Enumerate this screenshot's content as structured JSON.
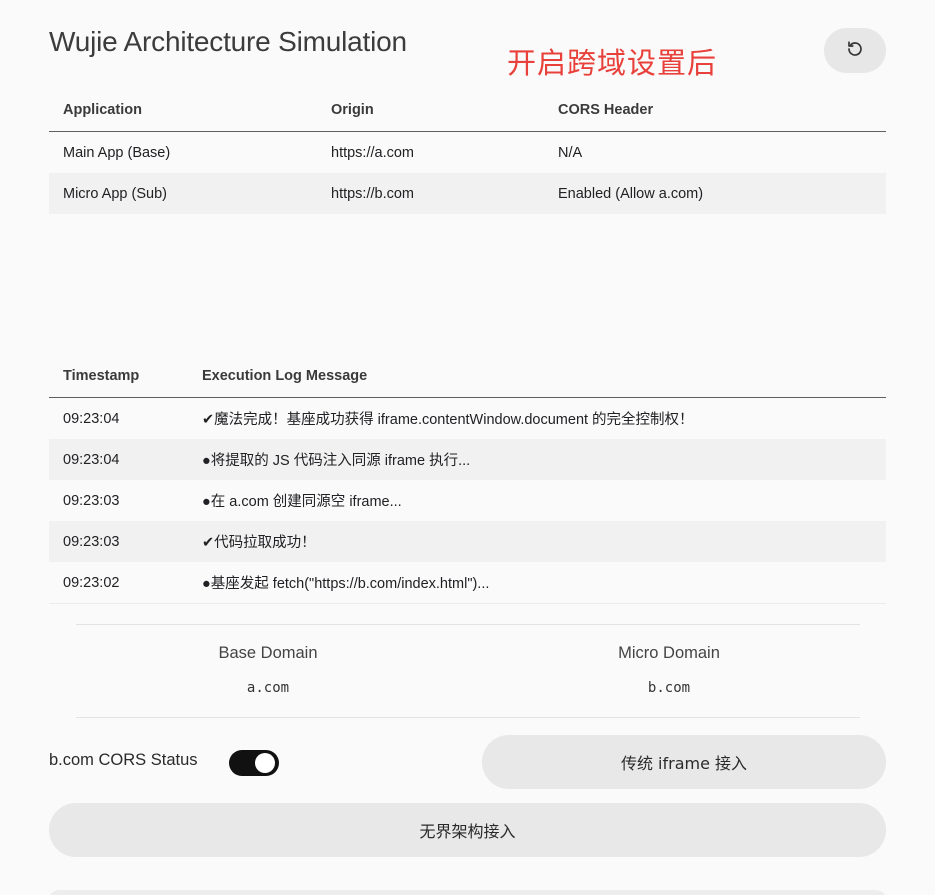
{
  "header": {
    "title": "Wujie Architecture Simulation",
    "annotation": "开启跨域设置后"
  },
  "app_table": {
    "columns": [
      "Application",
      "Origin",
      "CORS Header"
    ],
    "rows": [
      [
        "Main App (Base)",
        "https://a.com",
        "N/A"
      ],
      [
        "Micro App (Sub)",
        "https://b.com",
        "Enabled (Allow a.com)"
      ]
    ]
  },
  "log_table": {
    "columns": [
      "Timestamp",
      "Execution Log Message"
    ],
    "rows": [
      [
        "09:23:04",
        "✔魔法完成！基座成功获得 iframe.contentWindow.document 的完全控制权！"
      ],
      [
        "09:23:04",
        "●将提取的 JS 代码注入同源 iframe 执行..."
      ],
      [
        "09:23:03",
        "●在 a.com 创建同源空 iframe..."
      ],
      [
        "09:23:03",
        "✔代码拉取成功！"
      ],
      [
        "09:23:02",
        "●基座发起 fetch(\"https://b.com/index.html\")..."
      ]
    ]
  },
  "domains": {
    "base_label": "Base Domain",
    "base_value": "a.com",
    "micro_label": "Micro Domain",
    "micro_value": "b.com"
  },
  "controls": {
    "cors_label": "b.com CORS Status",
    "cors_enabled": true,
    "iframe_button": "传统 iframe 接入",
    "wujie_button": "无界架构接入",
    "reset_icon": "refresh-icon"
  }
}
